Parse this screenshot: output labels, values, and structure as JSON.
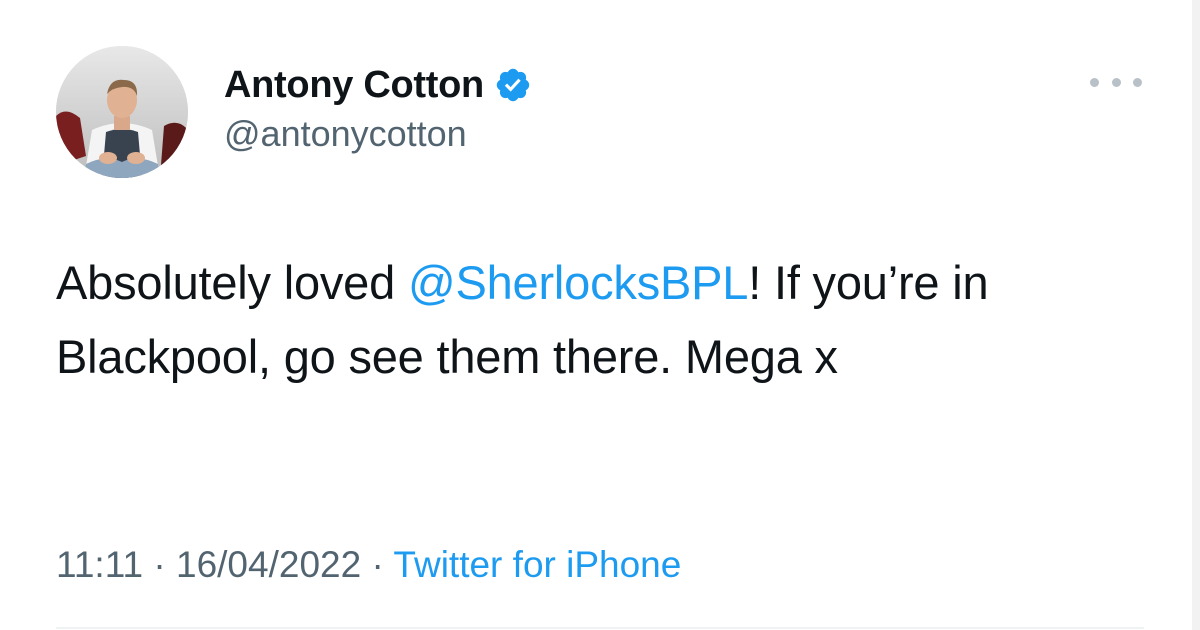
{
  "author": {
    "display_name": "Antony Cotton",
    "handle": "@antonycotton",
    "verified": true,
    "avatar_icon": "profile-photo"
  },
  "tweet": {
    "text_before": "Absolutely loved ",
    "mention": "@SherlocksBPL",
    "text_after": "! If you’re in Blackpool, go see them there. Mega x"
  },
  "meta": {
    "time": "11:11",
    "separator": "·",
    "date": "16/04/2022",
    "source": "Twitter for iPhone"
  },
  "colors": {
    "accent": "#1d9bf0",
    "text": "#0f1419",
    "muted": "#536471"
  },
  "icons": {
    "verified": "verified-badge-icon",
    "more": "more-options-icon"
  }
}
